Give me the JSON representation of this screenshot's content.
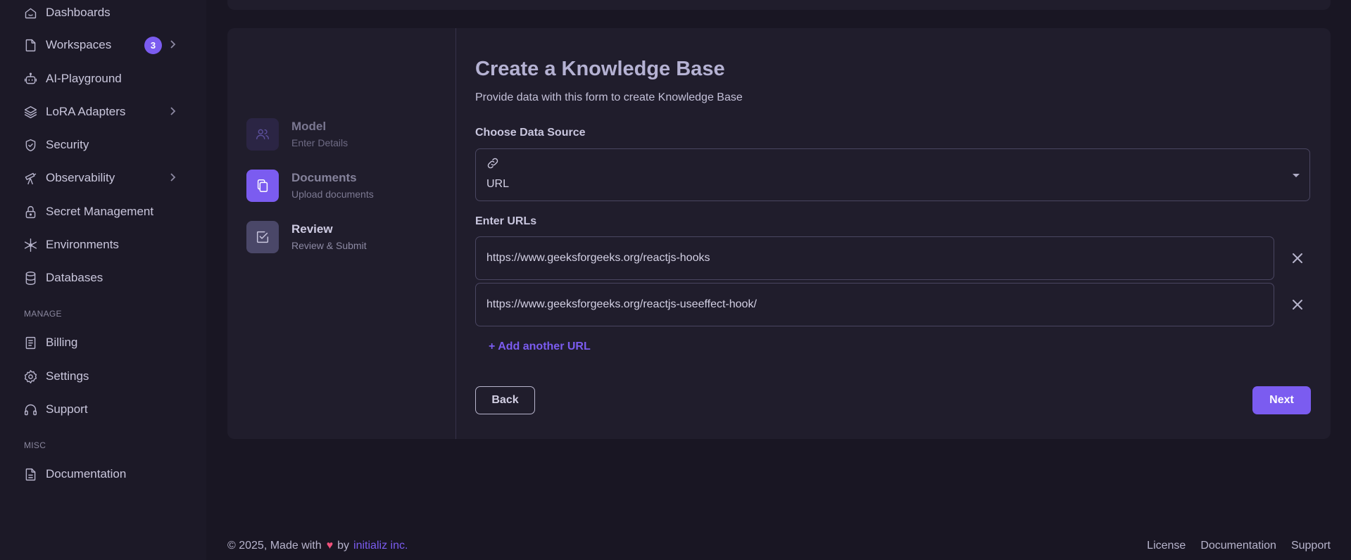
{
  "sidebar": {
    "items": [
      {
        "label": "Dashboards",
        "icon": "home-icon"
      },
      {
        "label": "Workspaces",
        "icon": "file-icon",
        "badge": "3"
      },
      {
        "label": "AI-Playground",
        "icon": "robot-icon"
      },
      {
        "label": "LoRA Adapters",
        "icon": "layers-icon"
      },
      {
        "label": "Security",
        "icon": "shield-check-icon"
      },
      {
        "label": "Observability",
        "icon": "telescope-icon"
      },
      {
        "label": "Secret Management",
        "icon": "lock-icon"
      },
      {
        "label": "Environments",
        "icon": "snowflake-icon"
      },
      {
        "label": "Databases",
        "icon": "database-icon"
      }
    ],
    "manage_label": "MANAGE",
    "manage_items": [
      {
        "label": "Billing",
        "icon": "receipt-icon"
      },
      {
        "label": "Settings",
        "icon": "gear-icon"
      },
      {
        "label": "Support",
        "icon": "headset-icon"
      }
    ],
    "misc_label": "MISC",
    "misc_items": [
      {
        "label": "Documentation",
        "icon": "document-icon"
      }
    ]
  },
  "stepper": {
    "steps": [
      {
        "title": "Model",
        "subtitle": "Enter Details",
        "icon": "users-icon"
      },
      {
        "title": "Documents",
        "subtitle": "Upload documents",
        "icon": "copy-icon"
      },
      {
        "title": "Review",
        "subtitle": "Review & Submit",
        "icon": "checkbox-icon"
      }
    ]
  },
  "form": {
    "title": "Create a Knowledge Base",
    "subtitle": "Provide data with this form to create Knowledge Base",
    "data_source_label": "Choose Data Source",
    "data_source_value": "URL",
    "urls_label": "Enter URLs",
    "urls": [
      "https://www.geeksforgeeks.org/reactjs-hooks",
      "https://www.geeksforgeeks.org/reactjs-useeffect-hook/"
    ],
    "add_url_label": "+ Add another URL",
    "back_label": "Back",
    "next_label": "Next"
  },
  "footer": {
    "copyright": "© 2025, Made with",
    "by": "by",
    "brand": "initializ inc.",
    "links": [
      "License",
      "Documentation",
      "Support"
    ]
  },
  "colors": {
    "accent": "#7b5cf0",
    "background": "#191623",
    "card": "#201d2c"
  }
}
